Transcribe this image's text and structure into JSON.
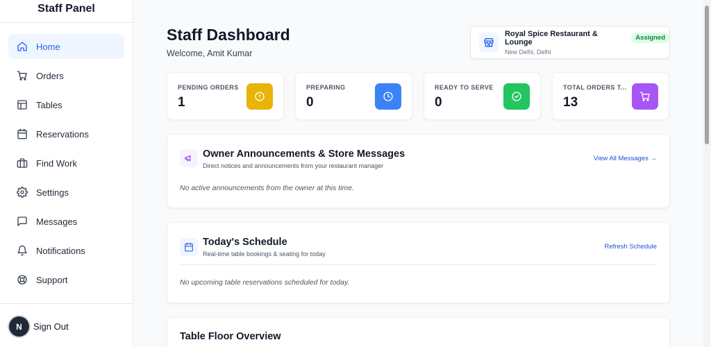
{
  "sidebar": {
    "brand": "Staff Panel",
    "items": [
      {
        "label": "Home",
        "icon": "home-icon",
        "active": true
      },
      {
        "label": "Orders",
        "icon": "cart-icon"
      },
      {
        "label": "Tables",
        "icon": "table-icon"
      },
      {
        "label": "Reservations",
        "icon": "calendar-icon"
      },
      {
        "label": "Find Work",
        "icon": "briefcase-icon"
      },
      {
        "label": "Settings",
        "icon": "gear-icon"
      },
      {
        "label": "Messages",
        "icon": "message-icon"
      },
      {
        "label": "Notifications",
        "icon": "bell-icon"
      },
      {
        "label": "Support",
        "icon": "lifebuoy-icon"
      }
    ],
    "avatar_initial": "N",
    "sign_out": "Sign Out"
  },
  "header": {
    "title": "Staff Dashboard",
    "welcome": "Welcome, Amit Kumar"
  },
  "restaurant": {
    "name": "Royal Spice Restaurant & Lounge",
    "badge": "Assigned",
    "location": "New Delhi, Delhi"
  },
  "stats": [
    {
      "label": "PENDING ORDERS",
      "value": "1",
      "color": "#eab308",
      "icon": "alert-circle-icon"
    },
    {
      "label": "PREPARING",
      "value": "0",
      "color": "#3b82f6",
      "icon": "clock-icon"
    },
    {
      "label": "READY TO SERVE",
      "value": "0",
      "color": "#22c55e",
      "icon": "check-circle-icon"
    },
    {
      "label": "TOTAL ORDERS T...",
      "value": "13",
      "color": "#a855f7",
      "icon": "cart-icon"
    }
  ],
  "announcements": {
    "title": "Owner Announcements & Store Messages",
    "subtitle": "Direct notices and announcements from your restaurant manager",
    "link": "View All Messages →",
    "empty": "No active announcements from the owner at this time."
  },
  "schedule": {
    "title": "Today's Schedule",
    "subtitle": "Real-time table bookings & seating for today",
    "link": "Refresh Schedule",
    "empty": "No upcoming table reservations scheduled for today."
  },
  "floor": {
    "title": "Table Floor Overview"
  }
}
